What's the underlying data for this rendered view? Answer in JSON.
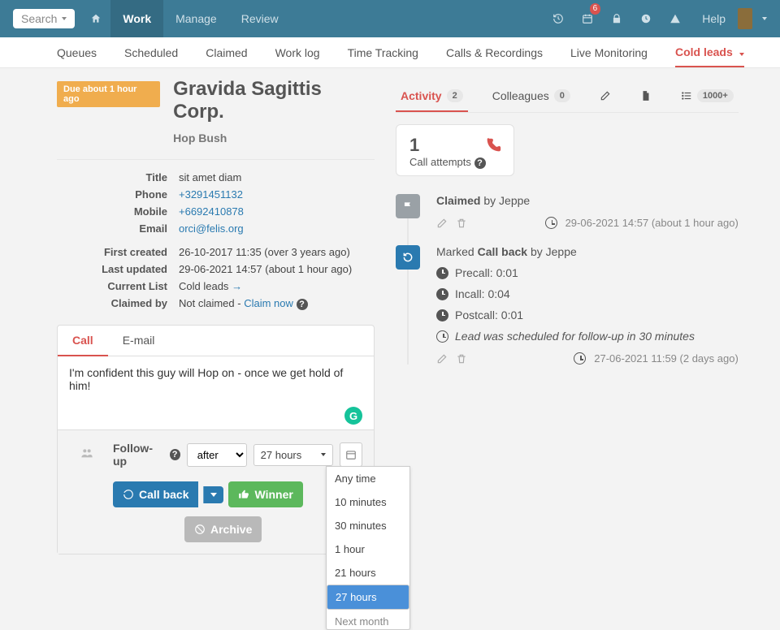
{
  "topnav": {
    "search_label": "Search",
    "items": [
      "Work",
      "Manage",
      "Review"
    ],
    "active_index": 0,
    "help_label": "Help",
    "calendar_badge": "6"
  },
  "subnav": {
    "items": [
      "Queues",
      "Scheduled",
      "Claimed",
      "Work log",
      "Time Tracking",
      "Calls & Recordings",
      "Live Monitoring",
      "Cold leads"
    ],
    "active_index": 7
  },
  "lead": {
    "due_badge": "Due about 1 hour ago",
    "title": "Gravida Sagittis Corp.",
    "subtitle": "Hop Bush",
    "fields": {
      "title_lbl": "Title",
      "title_val": "sit amet diam",
      "phone_lbl": "Phone",
      "phone_val": "+3291451132",
      "mobile_lbl": "Mobile",
      "mobile_val": "+6692410878",
      "email_lbl": "Email",
      "email_val": "orci@felis.org",
      "created_lbl": "First created",
      "created_val": "26-10-2017 11:35 (over 3 years ago)",
      "updated_lbl": "Last updated",
      "updated_val": "29-06-2021 14:57 (about 1 hour ago)",
      "list_lbl": "Current List",
      "list_val": "Cold leads",
      "claimed_lbl": "Claimed by",
      "claimed_prefix": "Not claimed - ",
      "claim_link": "Claim now"
    }
  },
  "notebox": {
    "tabs": [
      "Call",
      "E-mail"
    ],
    "active_tab": 0,
    "text": "I'm confident this guy will Hop on - once we get hold of him!",
    "followup_label": "Follow-up",
    "timing_value": "after",
    "duration_value": "27 hours",
    "duration_options": [
      "Any time",
      "10 minutes",
      "30 minutes",
      "1 hour",
      "21 hours",
      "27 hours",
      "Next month"
    ],
    "duration_selected_index": 5,
    "btn_callback": "Call back",
    "btn_winner": "Winner",
    "btn_archive": "Archive"
  },
  "right": {
    "tabs": {
      "activity": "Activity",
      "activity_count": "2",
      "colleagues": "Colleagues",
      "colleagues_count": "0",
      "more_count": "1000+"
    },
    "call_attempts_num": "1",
    "call_attempts_lbl": "Call attempts",
    "tl": [
      {
        "kind": "claimed",
        "action": "Claimed",
        "by": "by Jeppe",
        "ts": "29-06-2021 14:57 (about 1 hour ago)"
      },
      {
        "kind": "callback",
        "prefix": "Marked ",
        "action": "Call back",
        "by": "by Jeppe",
        "pre": "Precall: 0:01",
        "inc": "Incall: 0:04",
        "post": "Postcall: 0:01",
        "sched": "Lead was scheduled for follow-up in 30 minutes",
        "ts": "27-06-2021 11:59 (2 days ago)"
      }
    ]
  }
}
